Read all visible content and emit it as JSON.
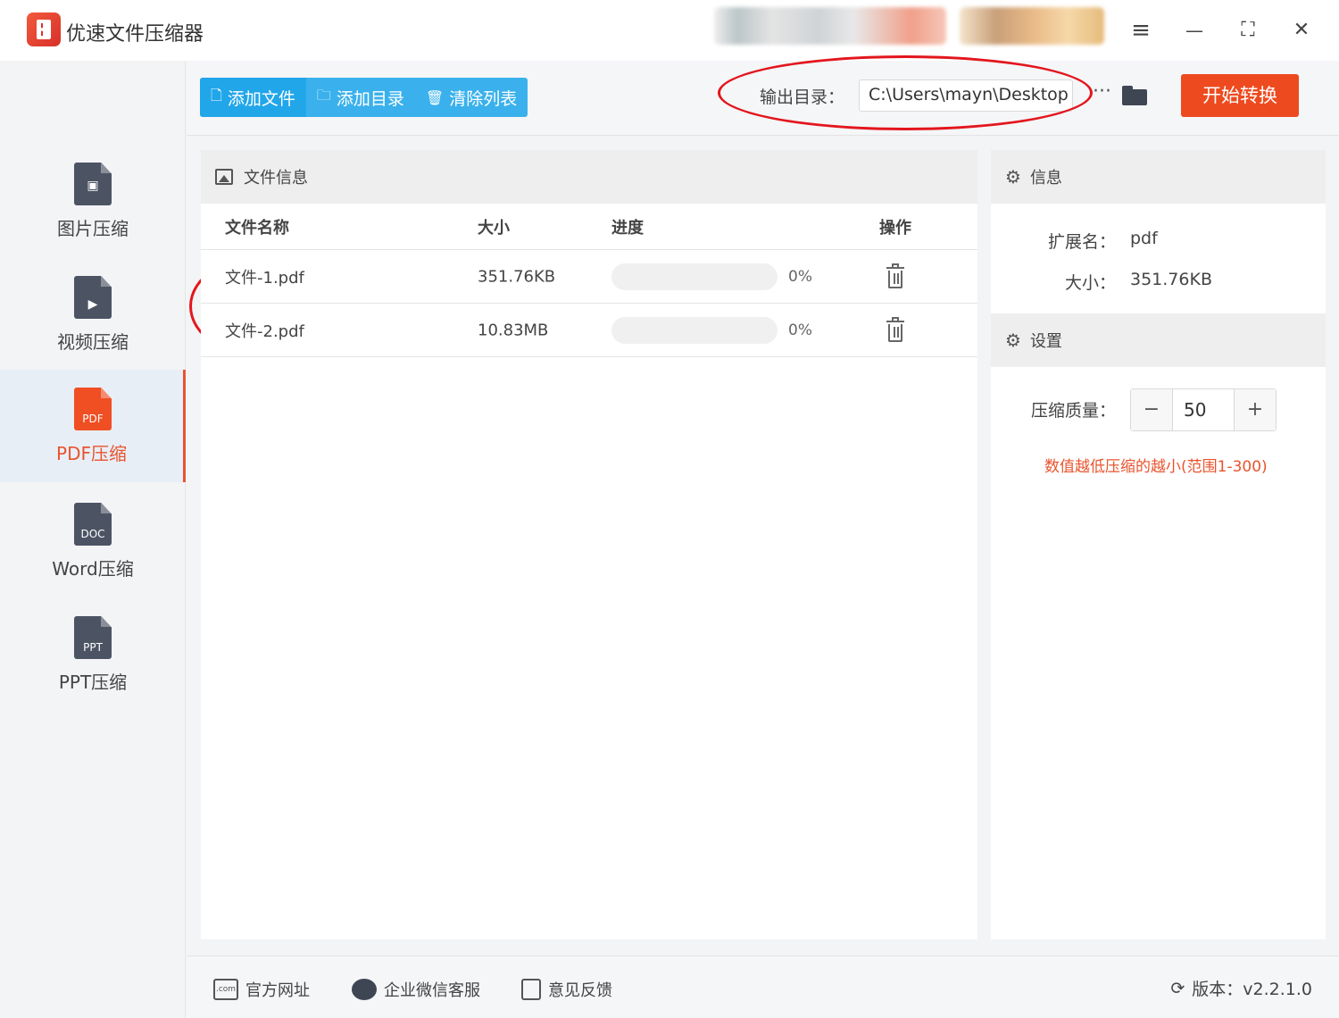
{
  "app": {
    "title": "优速文件压缩器"
  },
  "window_controls": {
    "menu": "≡",
    "minimize": "—",
    "maximize": "⛶",
    "close": "✕"
  },
  "sidebar": {
    "items": [
      {
        "label": "图片压缩",
        "icon": "image-file-icon",
        "badge": ""
      },
      {
        "label": "视频压缩",
        "icon": "video-file-icon",
        "badge": ""
      },
      {
        "label": "PDF压缩",
        "icon": "pdf-file-icon",
        "badge": "PDF",
        "active": true
      },
      {
        "label": "Word压缩",
        "icon": "doc-file-icon",
        "badge": "DOC"
      },
      {
        "label": "PPT压缩",
        "icon": "ppt-file-icon",
        "badge": "PPT"
      }
    ]
  },
  "toolbar": {
    "add_file": "添加文件",
    "add_folder": "添加目录",
    "clear_list": "清除列表",
    "output_label": "输出目录：",
    "output_path": "C:\\Users\\mayn\\Desktop",
    "more": "···",
    "start": "开始转换"
  },
  "file_panel": {
    "title": "文件信息",
    "columns": {
      "name": "文件名称",
      "size": "大小",
      "progress": "进度",
      "action": "操作"
    },
    "rows": [
      {
        "name": "文件-1.pdf",
        "size": "351.76KB",
        "progress": 0,
        "progress_text": "0%"
      },
      {
        "name": "文件-2.pdf",
        "size": "10.83MB",
        "progress": 0,
        "progress_text": "0%"
      }
    ]
  },
  "info_panel": {
    "title": "信息",
    "ext_label": "扩展名：",
    "ext_value": "pdf",
    "size_label": "大小：",
    "size_value": "351.76KB"
  },
  "settings_panel": {
    "title": "设置",
    "quality_label": "压缩质量：",
    "quality_value": "50",
    "minus": "−",
    "plus": "+",
    "hint": "数值越低压缩的越小(范围1-300)"
  },
  "footer": {
    "website": "官方网址",
    "website_icon_text": ".com",
    "wechat": "企业微信客服",
    "feedback": "意见反馈",
    "version": "版本：v2.2.1.0"
  },
  "colors": {
    "accent": "#ee4a1f",
    "blue": "#22a6ea",
    "annotation": "#e3161d"
  }
}
